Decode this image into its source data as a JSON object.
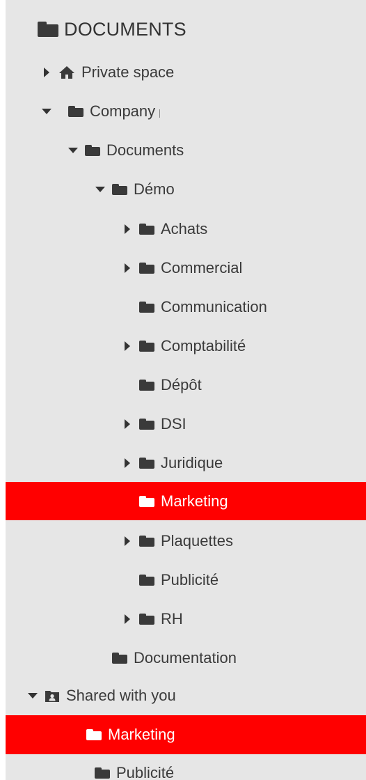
{
  "root": {
    "label": "DOCUMENTS"
  },
  "tree": {
    "private_space": "Private space",
    "company": "Company",
    "documents": "Documents",
    "demo": "Démo",
    "achats": "Achats",
    "commercial": "Commercial",
    "communication": "Communication",
    "comptabilite": "Comptabilité",
    "depot": "Dépôt",
    "dsi": "DSI",
    "juridique": "Juridique",
    "marketing": "Marketing",
    "plaquettes": "Plaquettes",
    "publicite": "Publicité",
    "rh": "RH",
    "documentation": "Documentation",
    "shared_with_you": "Shared with you",
    "shared_marketing": "Marketing",
    "shared_publicite": "Publicité"
  },
  "colors": {
    "selected_bg": "#ff0000",
    "panel_bg": "#e6e6e6",
    "text": "#3a3a3a"
  },
  "icons": {
    "home": "home-icon",
    "folder": "folder-icon",
    "shared": "shared-folder-icon"
  }
}
